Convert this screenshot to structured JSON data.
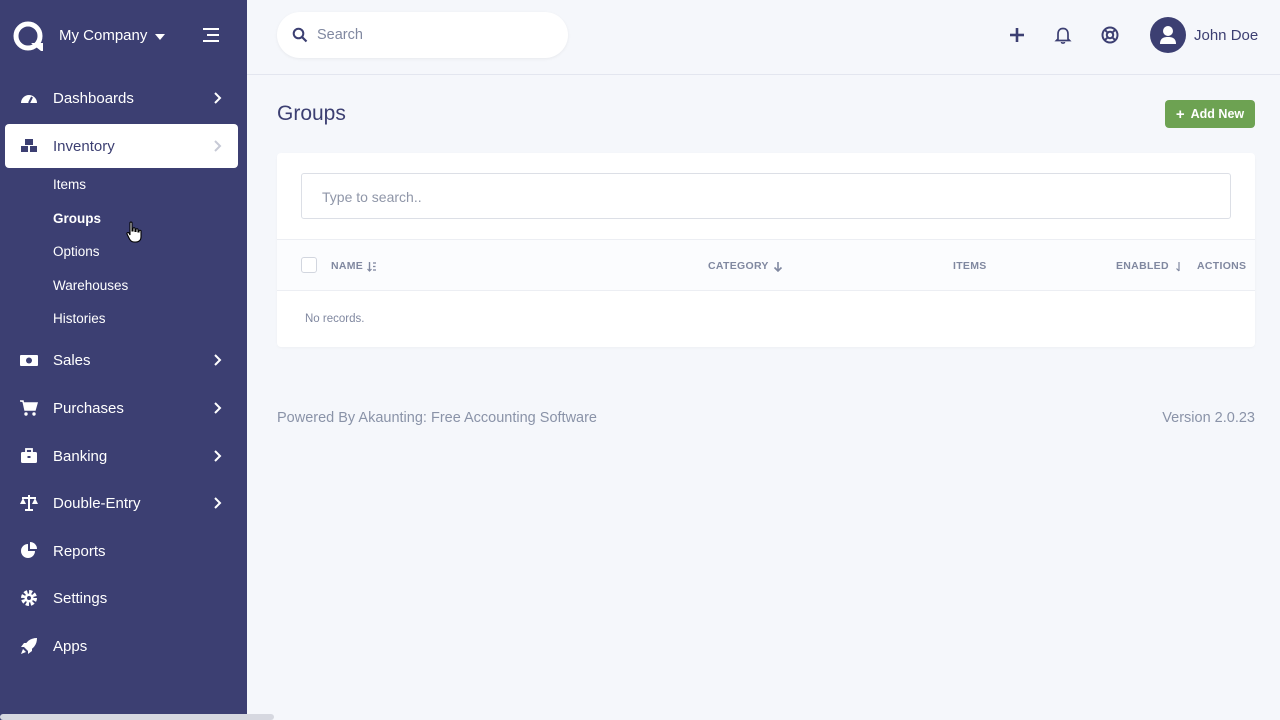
{
  "company": {
    "name": "My Company"
  },
  "sidebar": {
    "items": [
      {
        "label": "Dashboards",
        "icon": "dashboard-gauge-icon"
      },
      {
        "label": "Inventory",
        "icon": "cubes-icon"
      },
      {
        "label": "Sales",
        "icon": "money-bill-icon"
      },
      {
        "label": "Purchases",
        "icon": "shopping-cart-icon"
      },
      {
        "label": "Banking",
        "icon": "briefcase-icon"
      },
      {
        "label": "Double-Entry",
        "icon": "balance-scale-icon"
      },
      {
        "label": "Reports",
        "icon": "chart-pie-icon"
      },
      {
        "label": "Settings",
        "icon": "gear-icon"
      },
      {
        "label": "Apps",
        "icon": "rocket-icon"
      }
    ],
    "inventory_sub": [
      {
        "label": "Items"
      },
      {
        "label": "Groups"
      },
      {
        "label": "Options"
      },
      {
        "label": "Warehouses"
      },
      {
        "label": "Histories"
      }
    ]
  },
  "topbar": {
    "search_placeholder": "Search",
    "user_name": "John Doe"
  },
  "page": {
    "title": "Groups",
    "add_button": "Add New",
    "table_search_placeholder": "Type to search..",
    "columns": [
      "NAME",
      "CATEGORY",
      "ITEMS",
      "ENABLED",
      "ACTIONS"
    ],
    "empty_text": "No records."
  },
  "footer": {
    "powered_by": "Powered By Akaunting: Free Accounting Software",
    "version": "Version 2.0.23"
  },
  "colors": {
    "sidebar_bg": "#3c3f72",
    "page_bg": "#f5f7fb",
    "accent_green": "#6da252"
  }
}
